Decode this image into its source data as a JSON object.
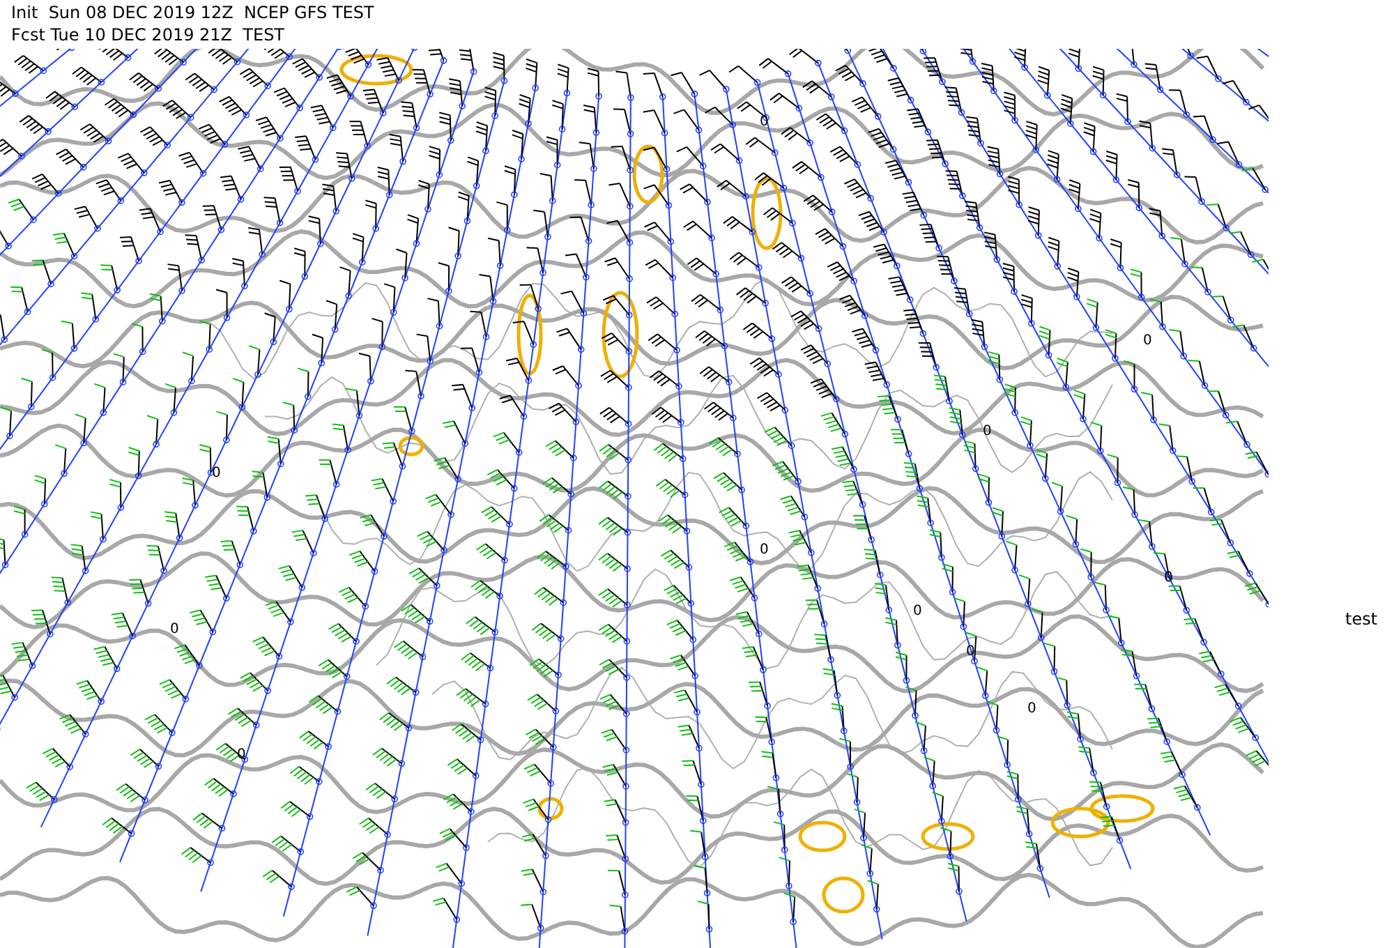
{
  "header": {
    "init_line": "Init  Sun 08 DEC 2019 12Z  NCEP GFS TEST",
    "forecast_line": "Fcst Tue 10 DEC 2019 21Z  TEST"
  },
  "map": {
    "contour_labels": [
      "0",
      "0",
      "0",
      "0",
      "0",
      "0",
      "0",
      "0",
      "0",
      "0",
      "0"
    ]
  },
  "side_label": "test"
}
